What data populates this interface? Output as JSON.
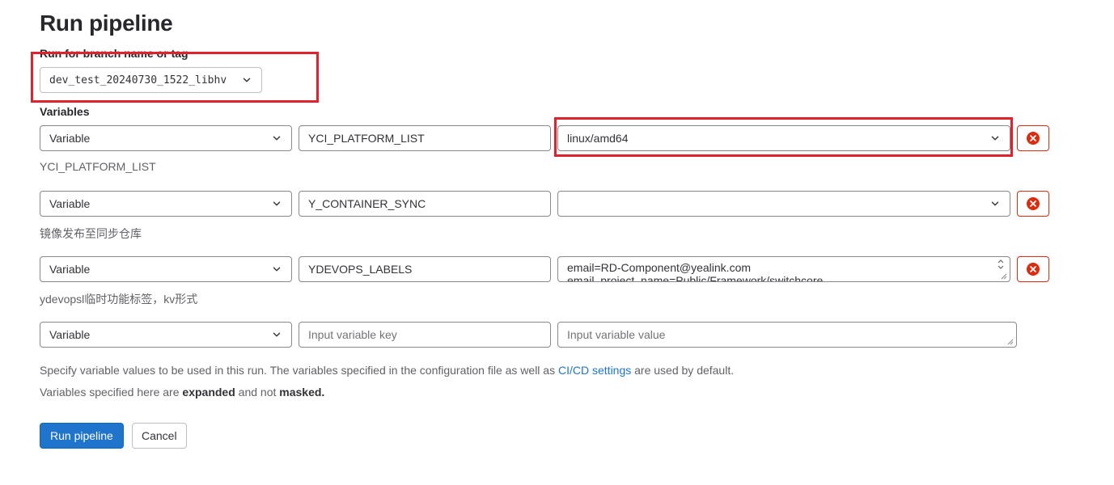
{
  "page": {
    "title": "Run pipeline",
    "branch_label": "Run for branch name or tag",
    "branch_value": "dev_test_20240730_1522_libhv",
    "variables_label": "Variables"
  },
  "variables": [
    {
      "type": "Variable",
      "key": "YCI_PLATFORM_LIST",
      "value": "linux/amd64",
      "description": "YCI_PLATFORM_LIST"
    },
    {
      "type": "Variable",
      "key": "Y_CONTAINER_SYNC",
      "value": "",
      "description": "镜像发布至同步仓库"
    },
    {
      "type": "Variable",
      "key": "YDEVOPS_LABELS",
      "value_line1": "email=RD-Component@yealink.com",
      "value_line2": "email_project_name=Public/Framework/switchcore",
      "description": "ydevopsl临时功能标签，kv形式"
    },
    {
      "type": "Variable",
      "key_placeholder": "Input variable key",
      "value_placeholder": "Input variable value"
    }
  ],
  "help": {
    "line1_pre": "Specify variable values to be used in this run. The variables specified in the configuration file as well as ",
    "line1_link": "CI/CD settings",
    "line1_post": " are used by default.",
    "line2_pre": "Variables specified here are ",
    "line2_b1": "expanded",
    "line2_mid": " and not ",
    "line2_b2": "masked."
  },
  "buttons": {
    "run": "Run pipeline",
    "cancel": "Cancel"
  },
  "colors": {
    "primary": "#1f75cb",
    "danger": "#dd2b0e",
    "annotation": "#e0222e"
  },
  "icons": [
    "chevron-down-icon",
    "remove-icon",
    "resize-icon",
    "spinner-icon"
  ]
}
